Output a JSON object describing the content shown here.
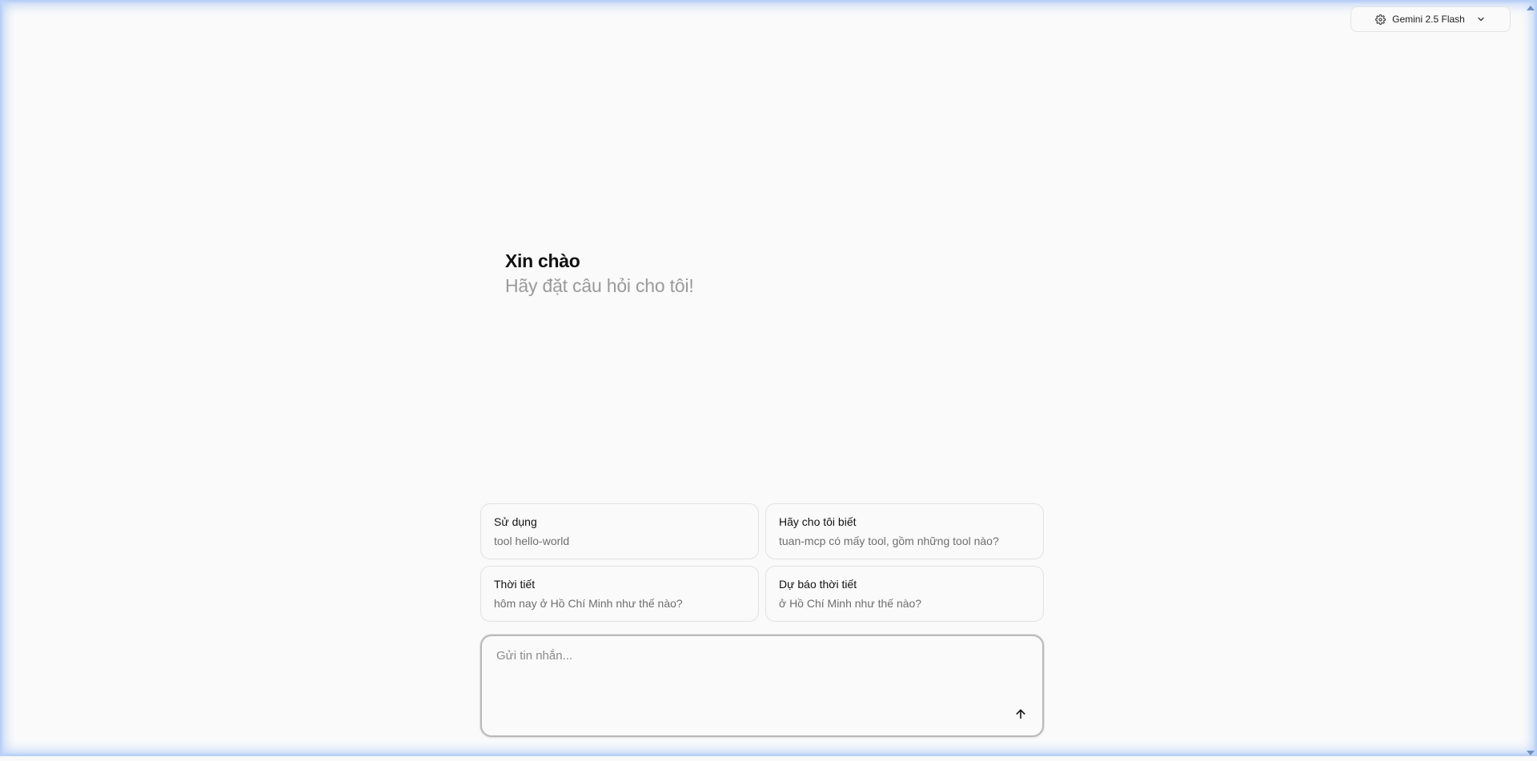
{
  "header": {
    "model_selector": {
      "label": "Gemini 2.5 Flash",
      "icon": "gear-icon",
      "dropdown_icon": "chevron-down-icon"
    }
  },
  "greeting": {
    "title": "Xin chào",
    "subtitle": "Hãy đặt câu hỏi cho tôi!"
  },
  "suggestions": [
    {
      "title": "Sử dụng",
      "subtitle": "tool hello-world"
    },
    {
      "title": "Hãy cho tôi biết",
      "subtitle": "tuan-mcp có mấy tool, gồm những tool nào?"
    },
    {
      "title": "Thời tiết",
      "subtitle": "hôm nay ở Hồ Chí Minh như thế nào?"
    },
    {
      "title": "Dự báo thời tiết",
      "subtitle": "ở Hồ Chí Minh như thế nào?"
    }
  ],
  "composer": {
    "placeholder": "Gửi tin nhắn...",
    "value": "",
    "send_icon": "arrow-up-icon"
  },
  "colors": {
    "background": "#fafafa",
    "frame_glow": "#bcd3f7",
    "border": "#e2e2e2",
    "muted_text": "#9a9a9a"
  }
}
